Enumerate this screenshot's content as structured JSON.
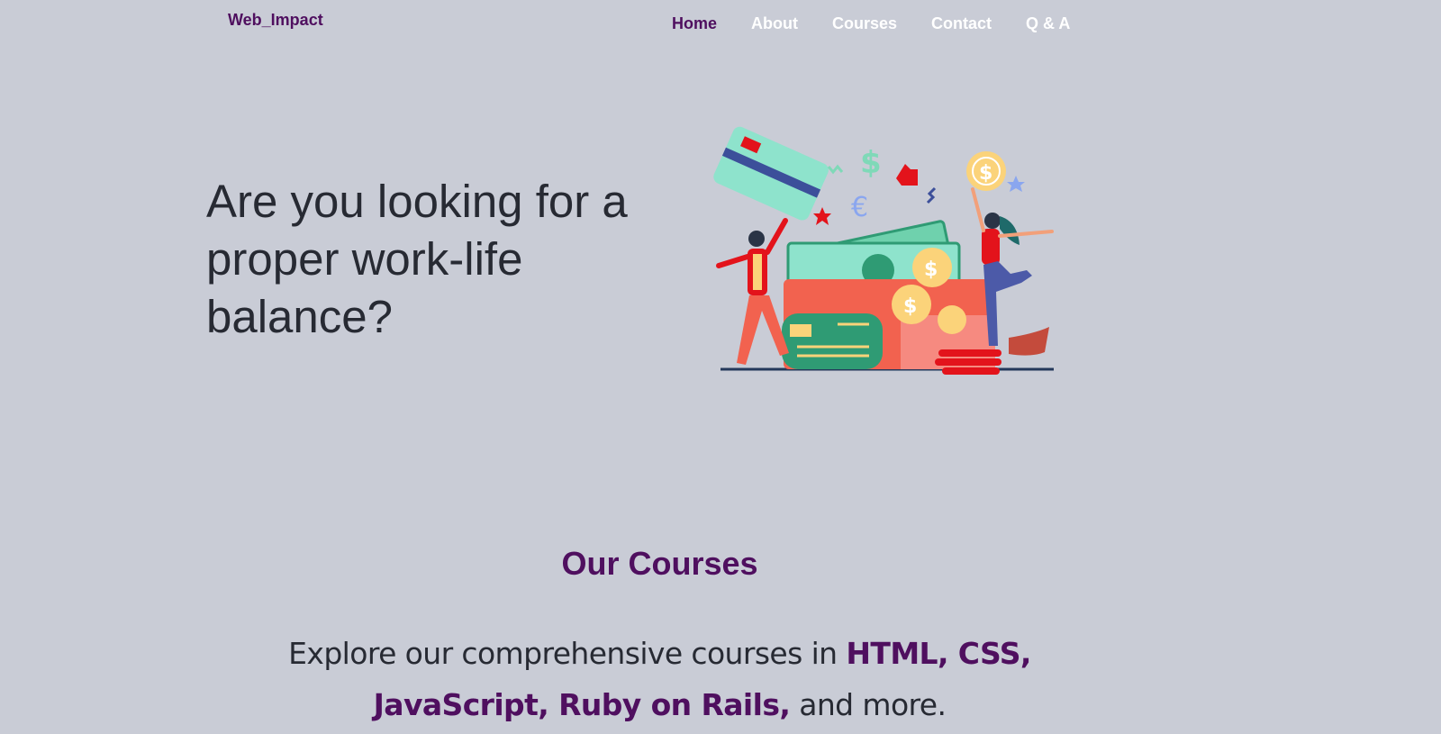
{
  "brand": {
    "name": "Web_Impact"
  },
  "nav": {
    "items": [
      {
        "label": "Home",
        "active": true
      },
      {
        "label": "About",
        "active": false
      },
      {
        "label": "Courses",
        "active": false
      },
      {
        "label": "Contact",
        "active": false
      },
      {
        "label": "Q & A",
        "active": false
      }
    ]
  },
  "hero": {
    "title": "Are you looking for a proper work-life balance?",
    "illustration_icon": "money-wallet-celebration-illustration"
  },
  "courses": {
    "title": "Our Courses",
    "desc_prefix": "Explore our comprehensive courses in ",
    "desc_highlight": "HTML, CSS, JavaScript, Ruby on Rails,",
    "desc_suffix": " and more."
  },
  "colors": {
    "background": "#c9ccd6",
    "brand": "#4f0f5f",
    "nav_text": "#ffffff",
    "body_text": "#272a33"
  }
}
